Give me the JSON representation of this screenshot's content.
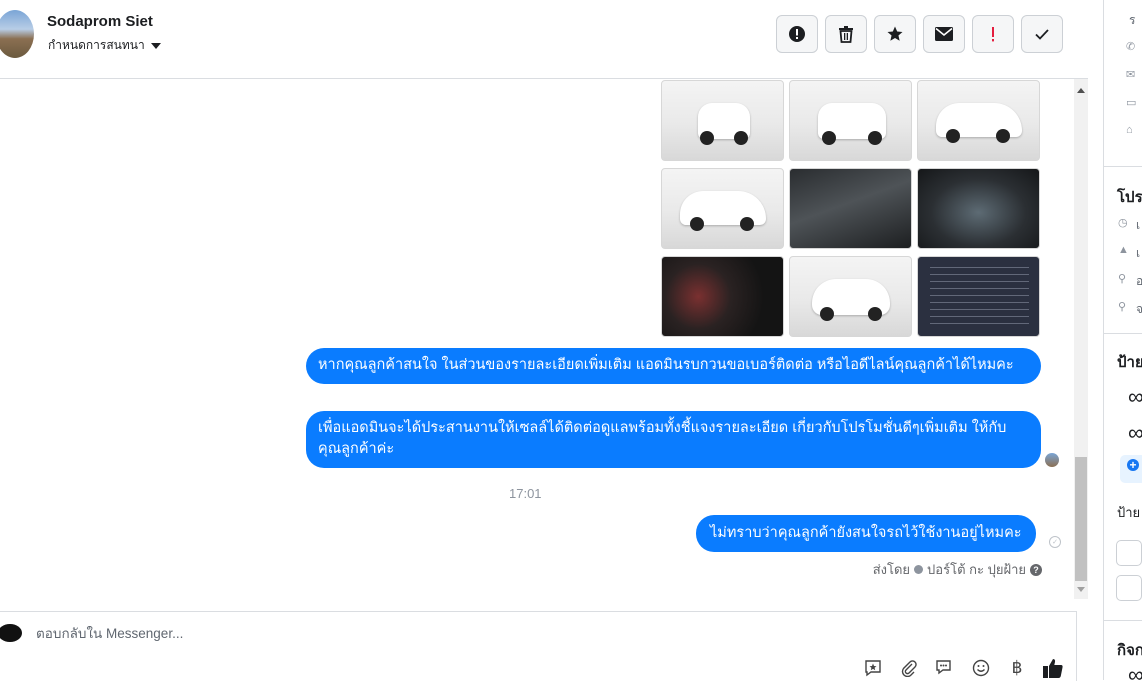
{
  "header": {
    "contact_name": "Sodaprom Siet",
    "assign_label": "กำหนดการสนทนา",
    "toolbar": [
      {
        "name": "spam-alert-button",
        "icon": "exclamation-circle-icon"
      },
      {
        "name": "delete-button",
        "icon": "trash-icon"
      },
      {
        "name": "star-button",
        "icon": "star-icon"
      },
      {
        "name": "mark-unread-button",
        "icon": "envelope-icon"
      },
      {
        "name": "follow-up-button",
        "icon": "red-exclamation-icon"
      },
      {
        "name": "mark-done-button",
        "icon": "checkmark-icon"
      }
    ]
  },
  "thread": {
    "photos": [
      {
        "kind": "car-rear"
      },
      {
        "kind": "car-rear-angle"
      },
      {
        "kind": "car-side"
      },
      {
        "kind": "car-side"
      },
      {
        "kind": "interior"
      },
      {
        "kind": "dashboard"
      },
      {
        "kind": "gauges"
      },
      {
        "kind": "car-front-angle"
      },
      {
        "kind": "document"
      }
    ],
    "messages": [
      {
        "text": "หากคุณลูกค้าสนใจ ในส่วนของรายละเอียดเพิ่มเติม แอดมินรบกวนขอเบอร์ติดต่อ หรือไอดีไลน์คุณลูกค้าได้ไหมคะ"
      },
      {
        "text": "เพื่อแอดมินจะได้ประสานงานให้เซลล์ได้ติดต่อดูแลพร้อมทั้งชี้แจงรายละเอียด เกี่ยวกับโปรโมชั่นดีๆเพิ่มเติม ให้กับคุณลูกค้าค่ะ"
      },
      {
        "text": "ไม่ทราบว่าคุณลูกค้ายังสนใจรถไว้ใช้งานอยู่ไหมคะ"
      }
    ],
    "timestamp": "17:01",
    "sent_by_label": "ส่งโดย",
    "sent_by_name": "ปอร์โต้ กะ ปุยฝ้าย"
  },
  "composer": {
    "placeholder": "ตอบกลับใน Messenger...",
    "tools": [
      "saved-reply-icon",
      "paperclip-icon",
      "chat-bubbles-icon",
      "emoji-icon",
      "baht-icon",
      "thumbs-up-icon"
    ]
  },
  "right_panel": {
    "top_text": "ร",
    "section_profile": "โปร",
    "section_labels": "ป้าย",
    "section_labels2": "ป้าย",
    "section_activity": "กิจก",
    "info_rows": [
      "เ",
      "เ",
      "อ",
      "จ"
    ],
    "glyph_inf": "∞"
  }
}
